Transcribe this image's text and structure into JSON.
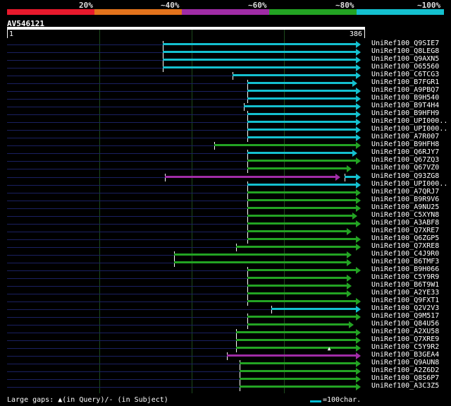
{
  "scale": {
    "labels": [
      "20%",
      "~40%",
      "~60%",
      "~80%",
      "~100%"
    ],
    "colors": [
      "#e8192c",
      "#e3731c",
      "#a02ca6",
      "#23a323",
      "#14c0cf"
    ]
  },
  "query": {
    "name": "AV546121",
    "start": "1",
    "end": "386",
    "length": 386
  },
  "legend": {
    "large_gaps_text": "Large gaps: ▲(in Query)/- (in Subject)",
    "scale_text": "=100char."
  },
  "hits": [
    {
      "label": "UniRef100_Q9SIE7",
      "segments": [
        {
          "start": 170,
          "end": 386,
          "color": "cyan"
        }
      ]
    },
    {
      "label": "UniRef100_Q8LEG8",
      "segments": [
        {
          "start": 170,
          "end": 386,
          "color": "cyan"
        }
      ]
    },
    {
      "label": "UniRef100_Q9AXN5",
      "segments": [
        {
          "start": 170,
          "end": 386,
          "color": "cyan"
        }
      ]
    },
    {
      "label": "UniRef100_O65560",
      "segments": [
        {
          "start": 170,
          "end": 386,
          "color": "cyan"
        }
      ]
    },
    {
      "label": "UniRef100_C6TCG3",
      "segments": [
        {
          "start": 246,
          "end": 386,
          "color": "cyan"
        }
      ]
    },
    {
      "label": "UniRef100_B7FGR1",
      "segments": [
        {
          "start": 262,
          "end": 382,
          "color": "cyan"
        }
      ]
    },
    {
      "label": "UniRef100_A9PBQ7",
      "segments": [
        {
          "start": 262,
          "end": 386,
          "color": "cyan"
        }
      ]
    },
    {
      "label": "UniRef100_B9H540",
      "segments": [
        {
          "start": 262,
          "end": 386,
          "color": "cyan"
        }
      ]
    },
    {
      "label": "UniRef100_B9T4H4",
      "segments": [
        {
          "start": 258,
          "end": 386,
          "color": "cyan"
        }
      ]
    },
    {
      "label": "UniRef100_B9HFH9",
      "segments": [
        {
          "start": 262,
          "end": 386,
          "color": "cyan"
        }
      ]
    },
    {
      "label": "UniRef100_UPI000..",
      "segments": [
        {
          "start": 262,
          "end": 386,
          "color": "cyan"
        }
      ]
    },
    {
      "label": "UniRef100_UPI000..",
      "segments": [
        {
          "start": 262,
          "end": 386,
          "color": "cyan"
        }
      ]
    },
    {
      "label": "UniRef100_A7R007",
      "segments": [
        {
          "start": 262,
          "end": 386,
          "color": "cyan"
        }
      ]
    },
    {
      "label": "UniRef100_B9HFH8",
      "segments": [
        {
          "start": 226,
          "end": 386,
          "color": "green"
        }
      ]
    },
    {
      "label": "UniRef100_Q6RJY7",
      "segments": [
        {
          "start": 262,
          "end": 382,
          "color": "cyan"
        }
      ]
    },
    {
      "label": "UniRef100_Q67ZQ3",
      "segments": [
        {
          "start": 262,
          "end": 386,
          "color": "green"
        }
      ]
    },
    {
      "label": "UniRef100_Q67VZ0",
      "segments": [
        {
          "start": 262,
          "end": 376,
          "color": "green"
        }
      ]
    },
    {
      "label": "UniRef100_Q93ZG8",
      "segments": [
        {
          "start": 172,
          "end": 386,
          "color": "magenta"
        },
        {
          "start": 388,
          "end": 386,
          "color": "cyan"
        }
      ],
      "split": 364
    },
    {
      "label": "UniRef100_UPI000..",
      "segments": [
        {
          "start": 262,
          "end": 386,
          "color": "cyan"
        }
      ]
    },
    {
      "label": "UniRef100_A7QRJ7",
      "segments": [
        {
          "start": 262,
          "end": 386,
          "color": "green"
        }
      ]
    },
    {
      "label": "UniRef100_B9R9V6",
      "segments": [
        {
          "start": 262,
          "end": 386,
          "color": "green"
        }
      ]
    },
    {
      "label": "UniRef100_A9NU25",
      "segments": [
        {
          "start": 262,
          "end": 386,
          "color": "green"
        }
      ]
    },
    {
      "label": "UniRef100_C5XYN8",
      "segments": [
        {
          "start": 262,
          "end": 382,
          "color": "green"
        }
      ]
    },
    {
      "label": "UniRef100_A3ABF8",
      "segments": [
        {
          "start": 262,
          "end": 386,
          "color": "green"
        }
      ]
    },
    {
      "label": "UniRef100_Q7XRE7",
      "segments": [
        {
          "start": 262,
          "end": 376,
          "color": "green"
        }
      ]
    },
    {
      "label": "UniRef100_Q6ZGP5",
      "segments": [
        {
          "start": 262,
          "end": 386,
          "color": "green"
        }
      ]
    },
    {
      "label": "UniRef100_Q7XRE8",
      "segments": [
        {
          "start": 250,
          "end": 386,
          "color": "green"
        }
      ]
    },
    {
      "label": "UniRef100_C4J9R0",
      "segments": [
        {
          "start": 182,
          "end": 376,
          "color": "green"
        }
      ]
    },
    {
      "label": "UniRef100_B6TMF3",
      "segments": [
        {
          "start": 182,
          "end": 376,
          "color": "green"
        }
      ]
    },
    {
      "label": "UniRef100_B9H066",
      "segments": [
        {
          "start": 262,
          "end": 386,
          "color": "green"
        }
      ]
    },
    {
      "label": "UniRef100_C5Y9R9",
      "segments": [
        {
          "start": 262,
          "end": 376,
          "color": "green"
        }
      ]
    },
    {
      "label": "UniRef100_B6T9W1",
      "segments": [
        {
          "start": 262,
          "end": 376,
          "color": "green"
        }
      ]
    },
    {
      "label": "UniRef100_A2YE33",
      "segments": [
        {
          "start": 262,
          "end": 376,
          "color": "green"
        }
      ]
    },
    {
      "label": "UniRef100_Q9FXT1",
      "segments": [
        {
          "start": 262,
          "end": 386,
          "color": "green"
        }
      ]
    },
    {
      "label": "UniRef100_Q2V2V3",
      "segments": [
        {
          "start": 288,
          "end": 386,
          "color": "cyan"
        }
      ]
    },
    {
      "label": "UniRef100_Q9M517",
      "segments": [
        {
          "start": 262,
          "end": 386,
          "color": "green"
        }
      ]
    },
    {
      "label": "UniRef100_Q84U56",
      "segments": [
        {
          "start": 262,
          "end": 378,
          "color": "green"
        }
      ]
    },
    {
      "label": "UniRef100_A2XU58",
      "segments": [
        {
          "start": 250,
          "end": 386,
          "color": "green"
        }
      ]
    },
    {
      "label": "UniRef100_Q7XRE9",
      "segments": [
        {
          "start": 250,
          "end": 386,
          "color": "green"
        }
      ]
    },
    {
      "label": "UniRef100_C5Y9R2",
      "segments": [
        {
          "start": 250,
          "end": 386,
          "color": "green"
        }
      ],
      "gap_marker": 352
    },
    {
      "label": "UniRef100_B3GEA4",
      "segments": [
        {
          "start": 240,
          "end": 386,
          "color": "magenta"
        }
      ]
    },
    {
      "label": "UniRef100_Q9AUN8",
      "segments": [
        {
          "start": 254,
          "end": 386,
          "color": "green"
        }
      ]
    },
    {
      "label": "UniRef100_A2Z6D2",
      "segments": [
        {
          "start": 254,
          "end": 386,
          "color": "green"
        }
      ]
    },
    {
      "label": "UniRef100_Q8S6P7",
      "segments": [
        {
          "start": 254,
          "end": 386,
          "color": "green"
        }
      ]
    },
    {
      "label": "UniRef100_A3C3Z5",
      "segments": [
        {
          "start": 254,
          "end": 386,
          "color": "green"
        }
      ]
    }
  ]
}
